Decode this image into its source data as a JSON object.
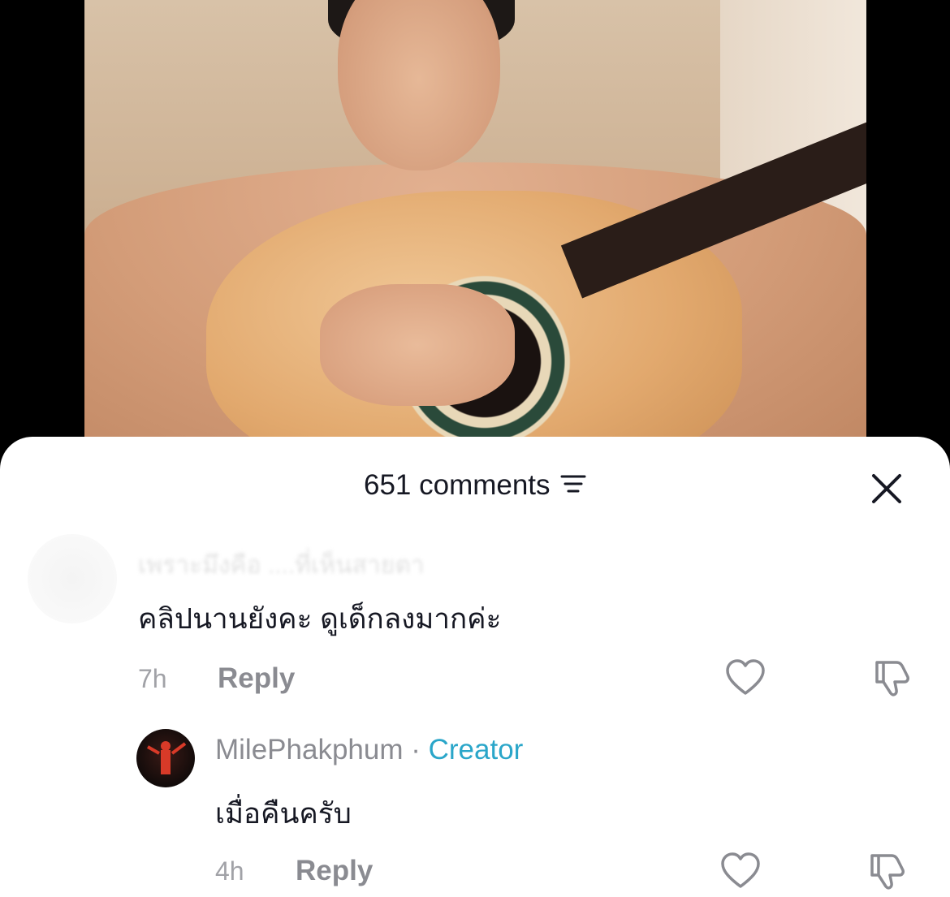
{
  "sheet": {
    "comment_count_label": "651 comments"
  },
  "comments": [
    {
      "username": "เพราะมึงคือ ....ที่เห็นสายตา",
      "text": "คลิปนานยังคะ ดูเด็กลงมากค่ะ",
      "time": "7h",
      "reply_label": "Reply"
    },
    {
      "username": "MilePhakphum",
      "separator": " · ",
      "badge": "Creator",
      "text": "เมื่อคืนครับ",
      "time": "4h",
      "reply_label": "Reply"
    }
  ],
  "icons": {
    "filter": "filter-icon",
    "close": "close-icon",
    "like": "heart-icon",
    "dislike": "thumbs-down-icon"
  },
  "colors": {
    "creator_badge": "#2aa6c9",
    "text_primary": "#161823",
    "text_secondary": "#8a8b91"
  }
}
